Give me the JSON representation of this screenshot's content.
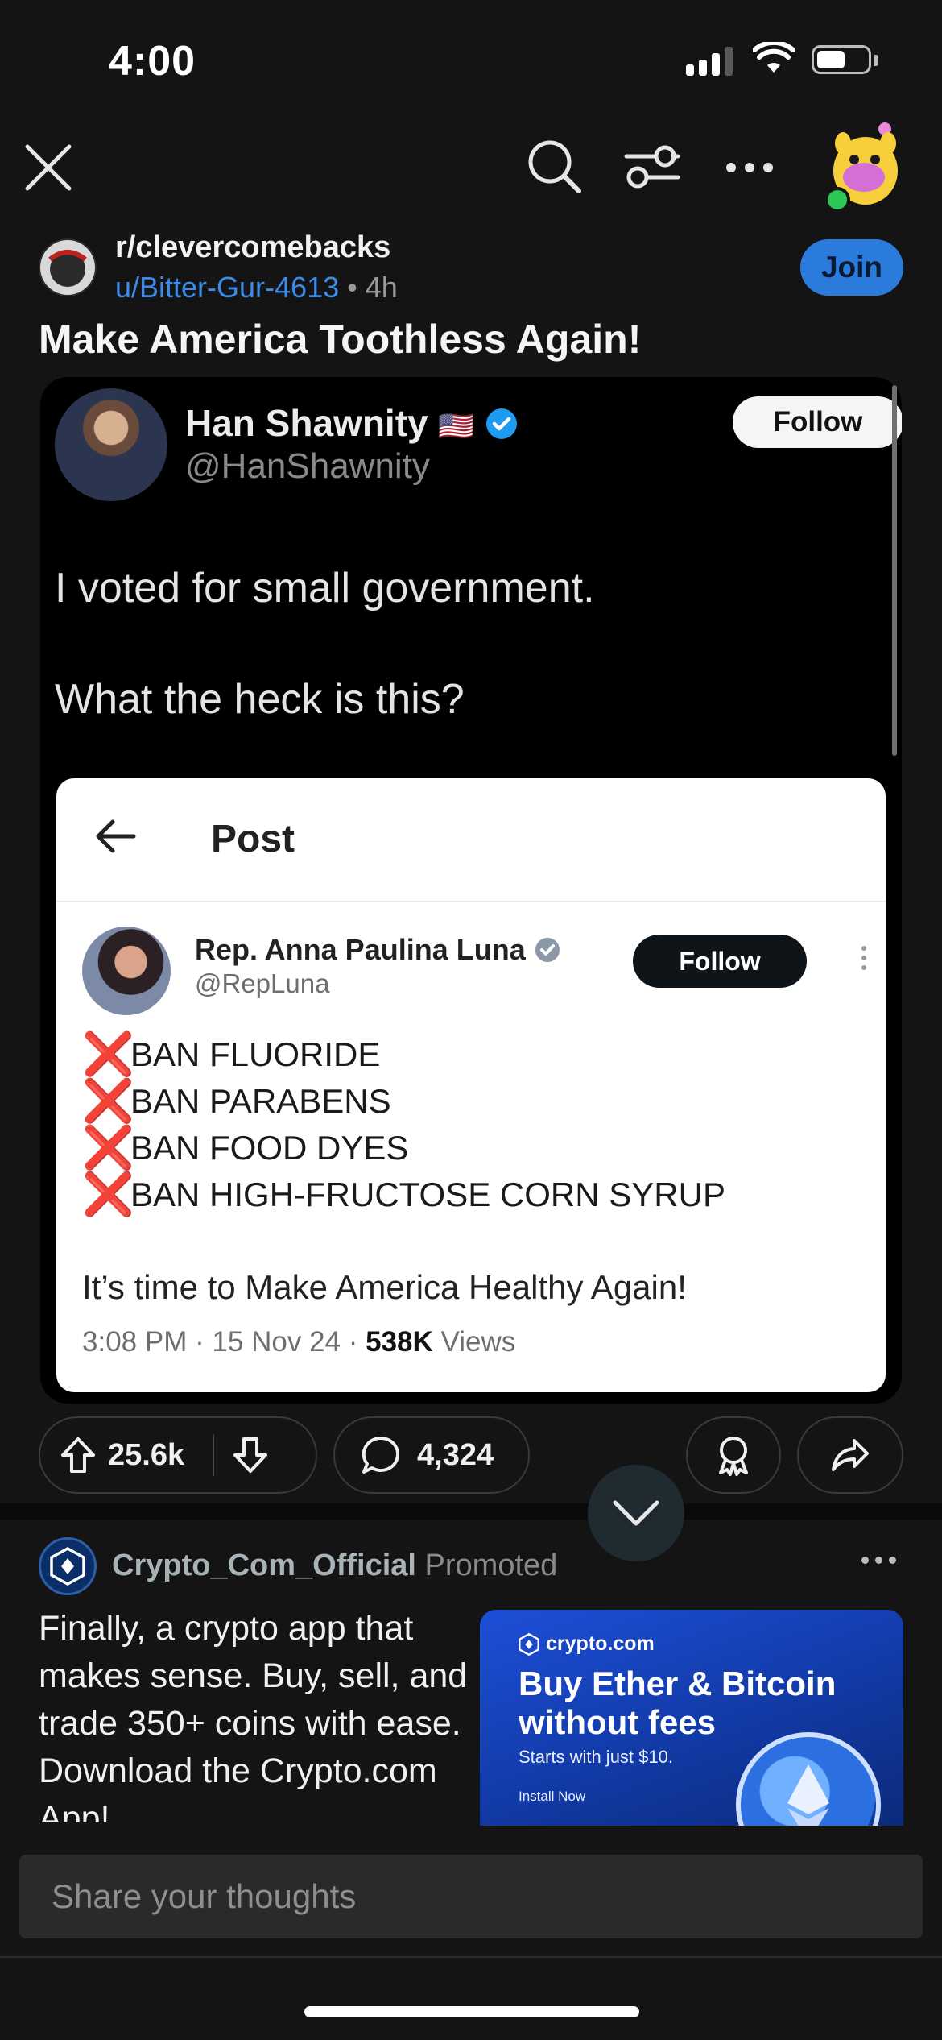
{
  "status_bar": {
    "time": "4:00"
  },
  "subreddit": {
    "name": "r/clevercomebacks",
    "user": "u/Bitter-Gur-4613",
    "separator": "•",
    "age": "4h",
    "join_label": "Join"
  },
  "post": {
    "title": "Make America Toothless Again!"
  },
  "tweet": {
    "author_name": "Han Shawnity",
    "author_flag": "🇺🇸",
    "handle": "@HanShawnity",
    "follow_label": "Follow",
    "line1": "I voted for small government.",
    "line2": "What the heck is this?"
  },
  "embedded": {
    "header": "Post",
    "name": "Rep. Anna Paulina Luna",
    "handle": "@RepLuna",
    "follow_label": "Follow",
    "bans": [
      {
        "mark": "❌",
        "text": "BAN FLUORIDE"
      },
      {
        "mark": "❌",
        "text": "BAN PARABENS"
      },
      {
        "mark": "❌",
        "text": "BAN FOOD DYES"
      },
      {
        "mark": "❌",
        "text": "BAN HIGH-FRUCTOSE CORN SYRUP"
      }
    ],
    "tagline": "It’s time to Make America Healthy Again!",
    "meta_prefix": "3:08 PM · 15 Nov 24 · ",
    "views_count": "538K",
    "views_label": " Views"
  },
  "actions": {
    "upvotes": "25.6k",
    "comments": "4,324"
  },
  "ad": {
    "advertiser": "Crypto_Com_Official",
    "promoted_label": "Promoted",
    "text": "Finally, a crypto app that makes sense. Buy, sell, and trade 350+ coins with ease. Download the Crypto.com App!",
    "image_brand": "crypto.com",
    "image_headline_1": "Buy Ether & Bitcoin",
    "image_headline_2": "without fees",
    "image_sub": "Starts with just $10.",
    "image_cta": "Install Now"
  },
  "comment_input": {
    "placeholder": "Share your thoughts"
  },
  "colors": {
    "accent_blue": "#2a7bdc",
    "link_blue": "#3d8be9",
    "x_red": "#e0245e",
    "background": "#141414"
  }
}
